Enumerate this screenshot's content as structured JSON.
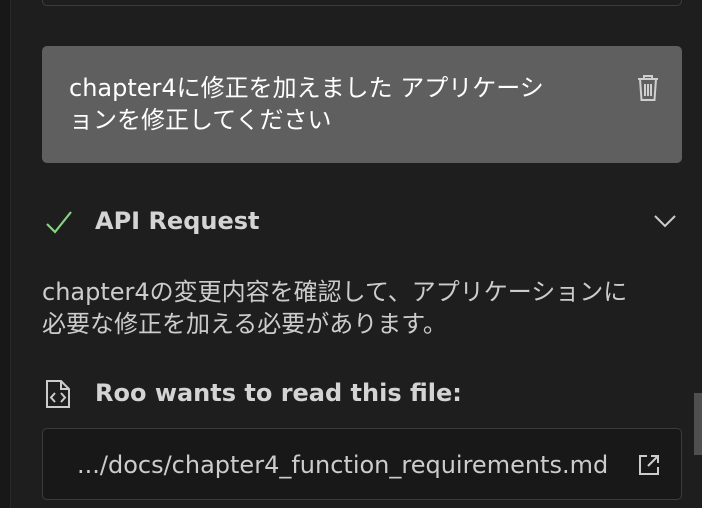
{
  "user_message": {
    "line1": "chapter4に修正を加えました アプリケーシ",
    "line2": "ョンを修正してください",
    "delete_icon": "trash-icon"
  },
  "api_request": {
    "status_icon": "check-icon",
    "title": "API Request",
    "expand_icon": "chevron-down-icon"
  },
  "assistant_message": {
    "line1": "chapter4の変更内容を確認して、アプリケーションに",
    "line2": "必要な修正を加える必要があります。"
  },
  "file_read": {
    "icon": "file-code-icon",
    "title": "Roo wants to read this file:",
    "path": ".../docs/chapter4_function_requirements.md",
    "open_icon": "external-link-icon"
  },
  "colors": {
    "background": "#1e1e1e",
    "user_bubble": "#5f5f5f",
    "success_check": "#89d185",
    "text": "#cccccc"
  }
}
